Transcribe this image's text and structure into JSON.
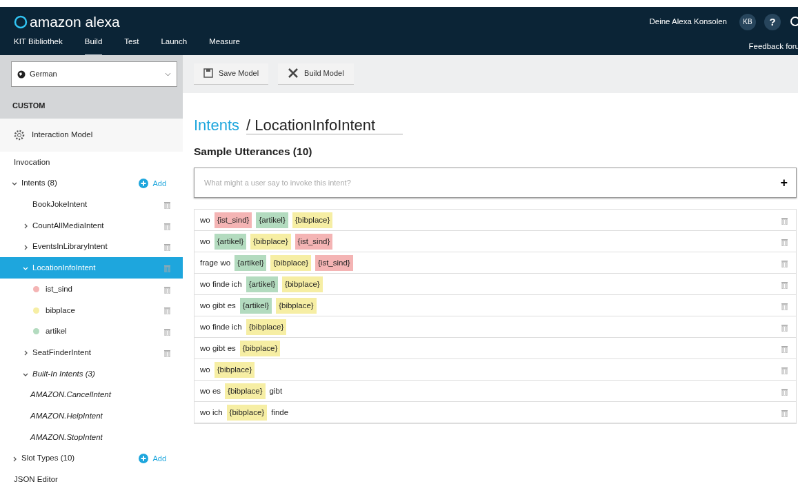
{
  "header": {
    "brand": "amazon alexa",
    "consoles": "Deine Alexa Konsolen",
    "avatar": "KB",
    "help": "?",
    "feedback": "Feedback foru"
  },
  "tabs": [
    {
      "label": "KIT Bibliothek",
      "selected": false
    },
    {
      "label": "Build",
      "selected": true
    },
    {
      "label": "Test",
      "selected": false
    },
    {
      "label": "Launch",
      "selected": false
    },
    {
      "label": "Measure",
      "selected": false
    }
  ],
  "sidebar": {
    "language": "German",
    "section": "CUSTOM",
    "model": "Interaction Model",
    "items": [
      {
        "kind": "link",
        "label": "Invocation",
        "selected": false
      },
      {
        "kind": "group",
        "label": "Intents (8)",
        "expanded": true,
        "action": "Add",
        "selected": false,
        "children": [
          {
            "kind": "intent",
            "label": "BookJokeIntent",
            "selected": false
          },
          {
            "kind": "intent",
            "label": "CountAllMediaIntent",
            "expanded": false,
            "selected": false
          },
          {
            "kind": "intent",
            "label": "EventsInLibraryIntent",
            "expanded": false,
            "selected": false
          },
          {
            "kind": "intent",
            "label": "LocationInfoIntent",
            "expanded": true,
            "selected": true,
            "children": [
              {
                "kind": "slot",
                "label": "ist_sind",
                "color": "#f4b4b4",
                "selected": false
              },
              {
                "kind": "slot",
                "label": "bibplace",
                "color": "#f6eea4",
                "selected": false
              },
              {
                "kind": "slot",
                "label": "artikel",
                "color": "#b3dbbf",
                "selected": false
              }
            ]
          },
          {
            "kind": "intent",
            "label": "SeatFinderIntent",
            "expanded": false,
            "selected": false
          },
          {
            "kind": "builtin-group",
            "label": "Built-In Intents (3)",
            "expanded": true,
            "selected": false,
            "children": [
              {
                "kind": "builtin",
                "label": "AMAZON.CancelIntent",
                "selected": false
              },
              {
                "kind": "builtin",
                "label": "AMAZON.HelpIntent",
                "selected": false
              },
              {
                "kind": "builtin",
                "label": "AMAZON.StopIntent",
                "selected": false
              }
            ]
          }
        ]
      },
      {
        "kind": "group",
        "label": "Slot Types (10)",
        "expanded": false,
        "action": "Add",
        "selected": false
      },
      {
        "kind": "link",
        "label": "JSON Editor",
        "selected": false
      }
    ]
  },
  "toolbar": {
    "buttons": [
      {
        "kind": "save",
        "label": "Save Model"
      },
      {
        "kind": "build",
        "label": "Build Model"
      }
    ]
  },
  "breadcrumb": {
    "parent": "Intents",
    "current": "/ LocationInfoIntent"
  },
  "utterances": {
    "heading": "Sample Utterances (10)",
    "placeholder": "What might a user say to invoke this intent?",
    "add": "+",
    "rows": [
      {
        "parts": [
          {
            "kind": "word",
            "text": "wo"
          },
          {
            "kind": "slot",
            "text": "{ist_sind}",
            "color": "#f4b4b4"
          },
          {
            "kind": "slot",
            "text": "{artikel}",
            "color": "#b3dbbf"
          },
          {
            "kind": "slot",
            "text": "{bibplace}",
            "color": "#f6eea4"
          }
        ]
      },
      {
        "parts": [
          {
            "kind": "word",
            "text": "wo"
          },
          {
            "kind": "slot",
            "text": "{artikel}",
            "color": "#b3dbbf"
          },
          {
            "kind": "slot",
            "text": "{bibplace}",
            "color": "#f6eea4"
          },
          {
            "kind": "slot",
            "text": "{ist_sind}",
            "color": "#f4b4b4"
          }
        ]
      },
      {
        "parts": [
          {
            "kind": "word",
            "text": "frage wo"
          },
          {
            "kind": "slot",
            "text": "{artikel}",
            "color": "#b3dbbf"
          },
          {
            "kind": "slot",
            "text": "{bibplace}",
            "color": "#f6eea4"
          },
          {
            "kind": "slot",
            "text": "{ist_sind}",
            "color": "#f4b4b4"
          }
        ]
      },
      {
        "parts": [
          {
            "kind": "word",
            "text": "wo finde ich"
          },
          {
            "kind": "slot",
            "text": "{artikel}",
            "color": "#b3dbbf"
          },
          {
            "kind": "slot",
            "text": "{bibplace}",
            "color": "#f6eea4"
          }
        ]
      },
      {
        "parts": [
          {
            "kind": "word",
            "text": "wo gibt es"
          },
          {
            "kind": "slot",
            "text": "{artikel}",
            "color": "#b3dbbf"
          },
          {
            "kind": "slot",
            "text": "{bibplace}",
            "color": "#f6eea4"
          }
        ]
      },
      {
        "parts": [
          {
            "kind": "word",
            "text": "wo finde ich"
          },
          {
            "kind": "slot",
            "text": "{bibplace}",
            "color": "#f6eea4"
          }
        ]
      },
      {
        "parts": [
          {
            "kind": "word",
            "text": "wo gibt es"
          },
          {
            "kind": "slot",
            "text": "{bibplace}",
            "color": "#f6eea4"
          }
        ]
      },
      {
        "parts": [
          {
            "kind": "word",
            "text": "wo"
          },
          {
            "kind": "slot",
            "text": "{bibplace}",
            "color": "#f6eea4"
          }
        ]
      },
      {
        "parts": [
          {
            "kind": "word",
            "text": "wo es"
          },
          {
            "kind": "slot",
            "text": "{bibplace}",
            "color": "#f6eea4"
          },
          {
            "kind": "word",
            "text": "gibt"
          }
        ]
      },
      {
        "parts": [
          {
            "kind": "word",
            "text": "wo ich"
          },
          {
            "kind": "slot",
            "text": "{bibplace}",
            "color": "#f6eea4"
          },
          {
            "kind": "word",
            "text": "finde"
          }
        ]
      }
    ]
  }
}
